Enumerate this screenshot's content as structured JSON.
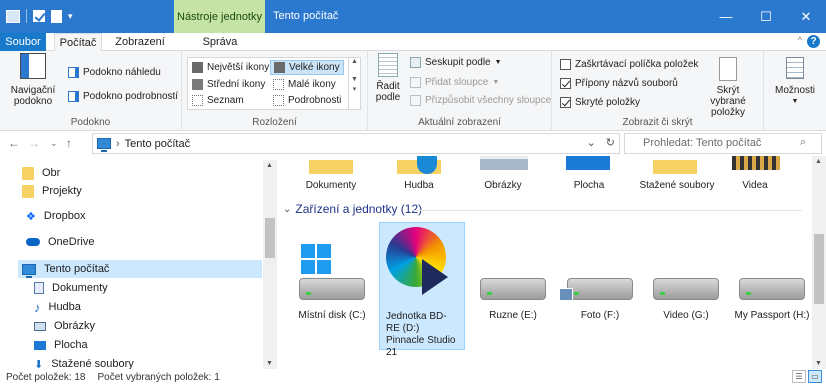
{
  "titlebar": {
    "context_tab": "Nástroje jednotky",
    "title": "Tento počítač",
    "minimize": "—",
    "maximize": "☐",
    "close": "✕"
  },
  "tabs": {
    "file": "Soubor",
    "computer": "Počítač",
    "view": "Zobrazení",
    "manage": "Správa"
  },
  "ribbon": {
    "panes": {
      "label": "Podokno",
      "nav_pane": "Navigační podokno",
      "preview_pane": "Podokno náhledu",
      "details_pane": "Podokno podrobností"
    },
    "layout": {
      "label": "Rozložení",
      "items": [
        "Největší ikony",
        "Velké ikony",
        "Střední ikony",
        "Malé ikony",
        "Seznam",
        "Podrobnosti"
      ],
      "selected": "Velké ikony"
    },
    "current_view": {
      "label": "Aktuální zobrazení",
      "sort": "Řadit podle",
      "group_by": "Seskupit podle",
      "add_columns": "Přidat sloupce",
      "fit_columns": "Přizpůsobit všechny sloupce"
    },
    "show_hide": {
      "label": "Zobrazit či skrýt",
      "item_checkboxes": "Zaškrtávací políčka položek",
      "extensions": "Přípony názvů souborů",
      "hidden_items": "Skryté položky",
      "hide_selected": "Skrýt vybrané položky",
      "item_checkboxes_checked": false,
      "extensions_checked": true,
      "hidden_items_checked": true
    },
    "options": "Možnosti"
  },
  "address": {
    "path": "Tento počítač",
    "search_placeholder": "Prohledat: Tento počítač"
  },
  "navpane": {
    "items": [
      {
        "label": "Obr",
        "icon": "folder-icon"
      },
      {
        "label": "Projekty",
        "icon": "folder-icon"
      },
      {
        "label": "Dropbox",
        "icon": "dropbox-icon"
      },
      {
        "label": "OneDrive",
        "icon": "onedrive-icon"
      },
      {
        "label": "Tento počítač",
        "icon": "computer-icon"
      },
      {
        "label": "Dokumenty",
        "icon": "documents-icon"
      },
      {
        "label": "Hudba",
        "icon": "music-icon"
      },
      {
        "label": "Obrázky",
        "icon": "pictures-icon"
      },
      {
        "label": "Plocha",
        "icon": "desktop-icon"
      },
      {
        "label": "Stažené soubory",
        "icon": "downloads-icon"
      }
    ]
  },
  "content": {
    "folders": [
      "Dokumenty",
      "Hudba",
      "Obrázky",
      "Plocha",
      "Stažené soubory",
      "Videa"
    ],
    "section": "Zařízení a jednotky (12)",
    "drives": [
      {
        "label": "Místní disk (C:)"
      },
      {
        "label": "Jednotka BD-RE (D:) Pinnacle Studio 21"
      },
      {
        "label": "Ruzne (E:)"
      },
      {
        "label": "Foto (F:)"
      },
      {
        "label": "Video (G:)"
      },
      {
        "label": "My Passport (H:)"
      }
    ]
  },
  "status": {
    "count": "Počet položek: 18",
    "selected": "Počet vybraných položek: 1"
  },
  "colors": {
    "accent": "#2b78cf",
    "context_tab": "#c5e3a5",
    "selection": "#cce8ff"
  }
}
